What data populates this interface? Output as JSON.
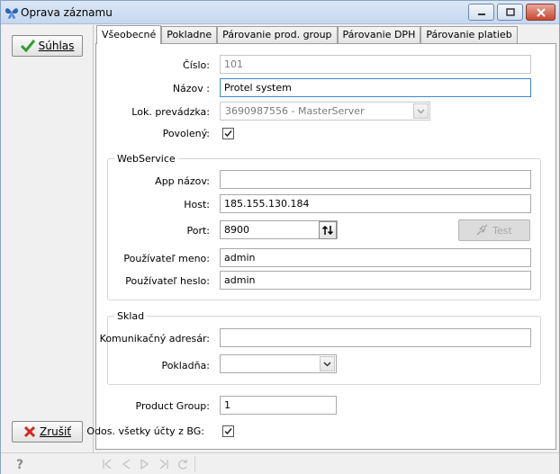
{
  "window": {
    "title": "Oprava záznamu"
  },
  "actions": {
    "confirm_label": "Súhlas",
    "cancel_label": "Zrušiť"
  },
  "tabs": [
    {
      "label": "Všeobecné",
      "active": true
    },
    {
      "label": "Pokladne"
    },
    {
      "label": "Párovanie prod. group"
    },
    {
      "label": "Párovanie DPH"
    },
    {
      "label": "Párovanie platieb"
    }
  ],
  "general": {
    "cislo_label": "Číslo:",
    "cislo_value": "101",
    "nazov_label": "Názov :",
    "nazov_value": "Protel system",
    "prevadzka_label": "Lok. prevádzka:",
    "prevadzka_value": "3690987556 - MasterServer",
    "povoleny_label": "Povolený:",
    "povoleny_checked": true
  },
  "webservice": {
    "group_title": "WebService",
    "app_label": "App názov:",
    "app_value": "",
    "host_label": "Host:",
    "host_value": "185.155.130.184",
    "port_label": "Port:",
    "port_value": "8900",
    "test_label": "Test",
    "user_label": "Používateľ meno:",
    "user_value": "admin",
    "pass_label": "Používateľ heslo:",
    "pass_value": "admin"
  },
  "sklad": {
    "group_title": "Sklad",
    "dir_label": "Komunikačný adresár:",
    "dir_value": "",
    "pokladna_label": "Pokladňa:",
    "pokladna_value": ""
  },
  "bottom": {
    "product_group_label": "Product Group:",
    "product_group_value": "1",
    "odos_label": "Odos. všetky účty z BG:",
    "odos_checked": true
  },
  "colors": {
    "accept_check": "#2f9e2f",
    "cancel_x": "#d0281e",
    "focus_border": "#3d86d1"
  }
}
